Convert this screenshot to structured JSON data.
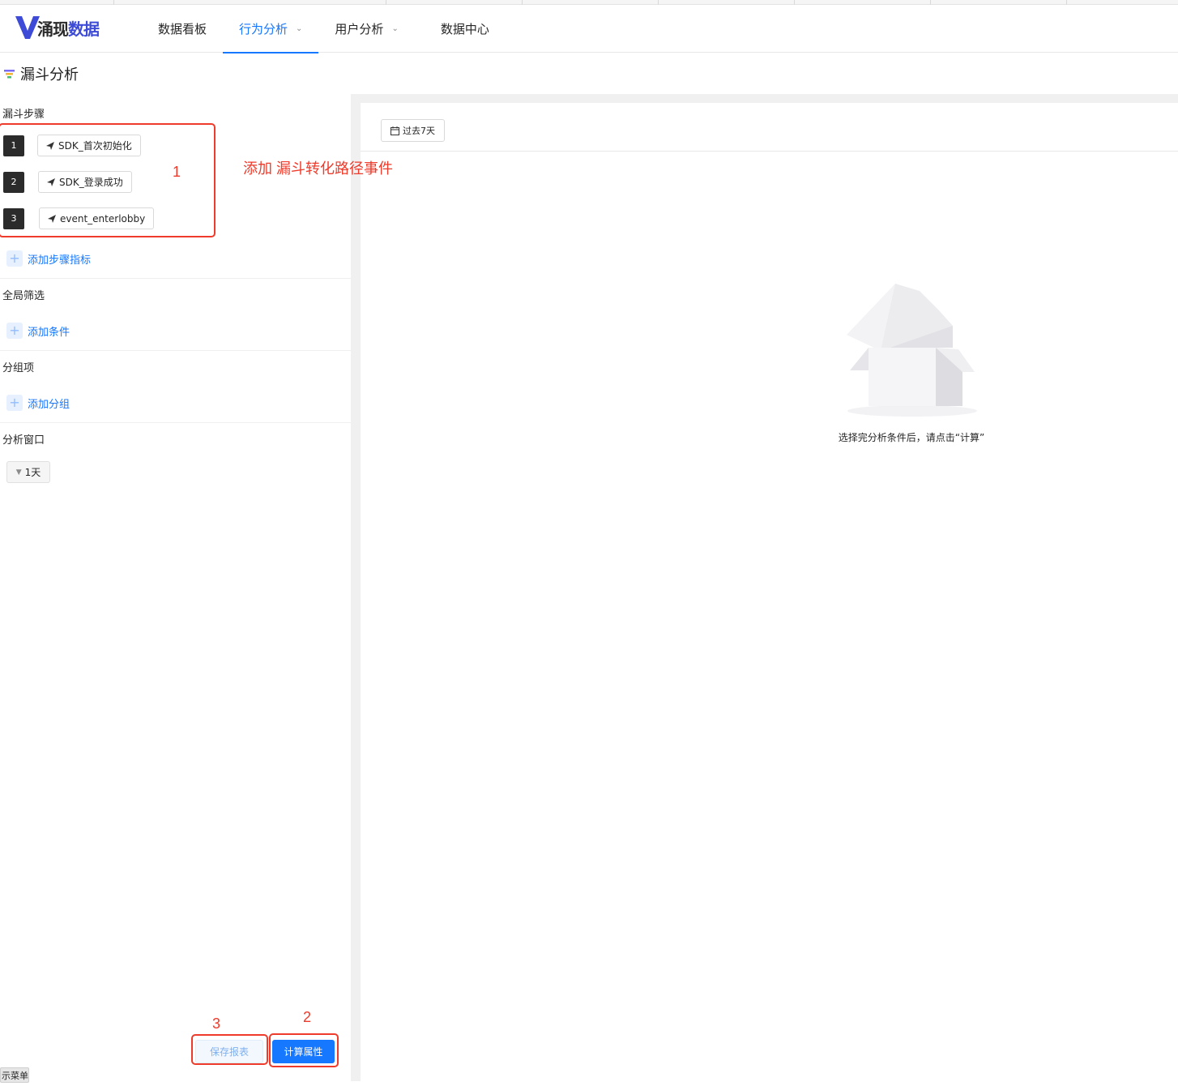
{
  "brand": {
    "name_main": "涌现",
    "name_accent": "数据"
  },
  "nav": [
    {
      "label": "数据看板",
      "active": false,
      "has_dropdown": false
    },
    {
      "label": "行为分析",
      "active": true,
      "has_dropdown": true
    },
    {
      "label": "用户分析",
      "active": false,
      "has_dropdown": true
    },
    {
      "label": "数据中心",
      "active": false,
      "has_dropdown": false
    }
  ],
  "page": {
    "title": "漏斗分析"
  },
  "funnel_steps": {
    "label": "漏斗步骤",
    "steps": [
      {
        "num": "1",
        "event": "SDK_首次初始化"
      },
      {
        "num": "2",
        "event": "SDK_登录成功"
      },
      {
        "num": "3",
        "event": "event_enterlobby"
      }
    ],
    "add_label": "添加步骤指标"
  },
  "global_filter": {
    "label": "全局筛选",
    "add_label": "添加条件"
  },
  "group_by": {
    "label": "分组项",
    "add_label": "添加分组"
  },
  "analysis_window": {
    "label": "分析窗口",
    "value": "1天"
  },
  "date_range": {
    "label": "过去7天"
  },
  "empty_state": {
    "message": "选择完分析条件后，请点击“计算”"
  },
  "actions": {
    "save_label": "保存报表",
    "calc_label": "计算属性"
  },
  "menu_chip": {
    "label": "示菜单"
  },
  "annotations": {
    "box1_num": "1",
    "box1_text": "添加 漏斗转化路径事件",
    "box2_num": "2",
    "box3_num": "3"
  },
  "colors": {
    "accent": "#1677ff",
    "annotation": "#ee3b2b",
    "step_badge": "#2b2b2b"
  }
}
